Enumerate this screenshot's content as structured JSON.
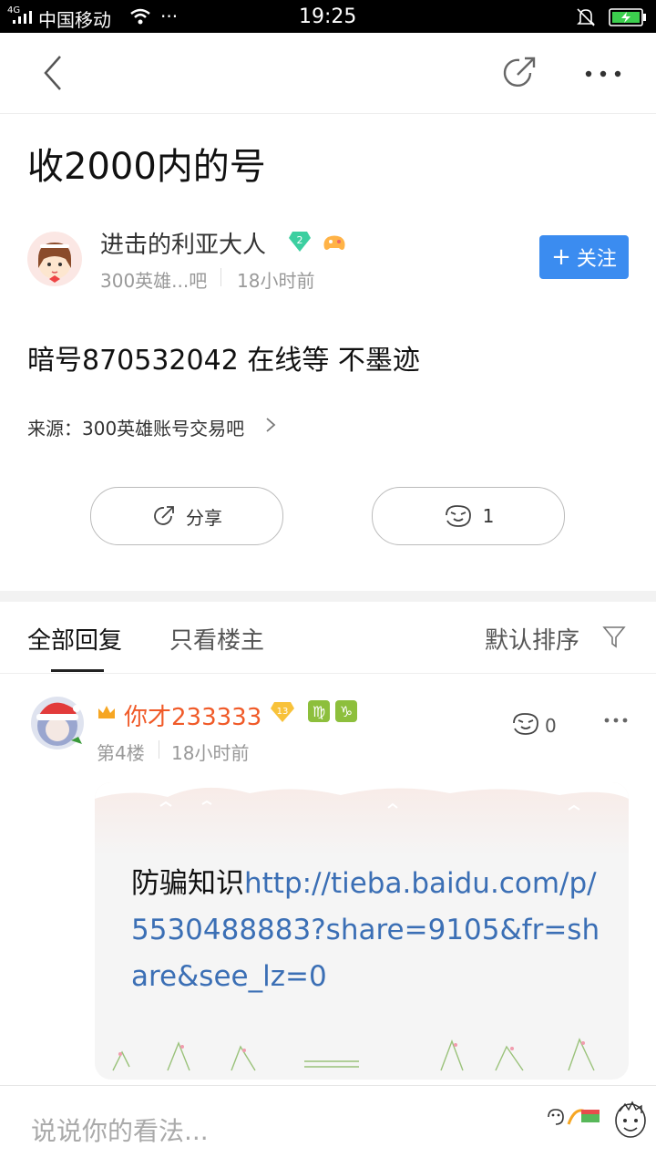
{
  "status_bar": {
    "carrier": "中国移动",
    "network": "4G",
    "time": "19:25"
  },
  "nav": {
    "back_icon": "chevron-left-icon",
    "share_icon": "share-arrow-icon",
    "more_icon": "more-dots-icon"
  },
  "post": {
    "title": "收2000内的号",
    "author": {
      "name": "进击的利亚大人",
      "level": "2",
      "forum": "300英雄...吧",
      "time": "18小时前"
    },
    "follow_label": "关注",
    "content": "暗号870532042 在线等 不墨迹",
    "source": "来源：300英雄账号交易吧",
    "share_label": "分享",
    "like_count": "1"
  },
  "tabs": {
    "all": "全部回复",
    "owner_only": "只看楼主",
    "sort": "默认排序"
  },
  "reply": {
    "username": "你才233333",
    "level": "13",
    "floor": "第4楼",
    "time": "18小时前",
    "like_count": "0",
    "text_prefix": "防骗知识",
    "link": "http://tieba.baidu.com/p/5530488883?share=9105&fr=share&see_lz=0"
  },
  "input": {
    "placeholder": "说说你的看法..."
  },
  "colors": {
    "accent": "#3b8cf0",
    "username": "#f05a28",
    "link": "#3b6fb5"
  }
}
